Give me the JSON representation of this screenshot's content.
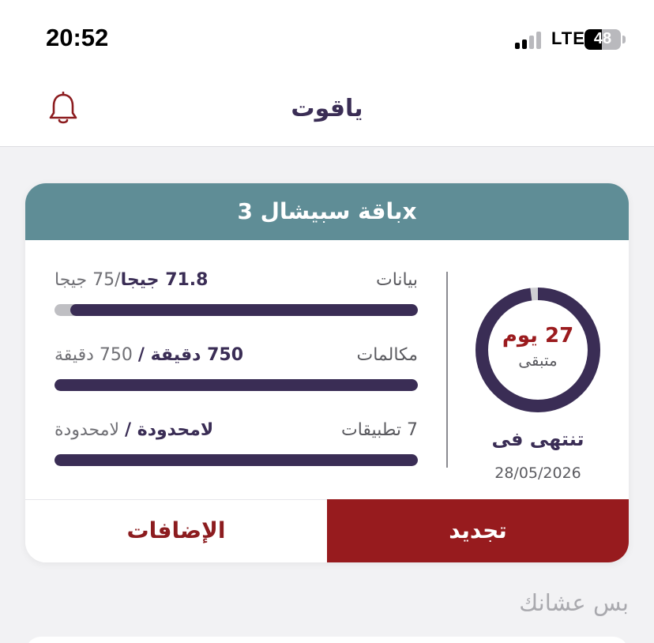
{
  "status_bar": {
    "time": "20:52",
    "network": "LTE",
    "battery": "48",
    "battery_level": 0.48
  },
  "nav": {
    "title": "ياقوت",
    "icon": "bell-icon"
  },
  "plan": {
    "name": "باقة سبيشال 3x",
    "usage": [
      {
        "label": "بيانات",
        "used": "71.8 جيجا",
        "total": "/75 جيجا",
        "remaining_fraction": 0.957
      },
      {
        "label": "مكالمات",
        "used": "750 دقيقة /",
        "total": "750 دقيقة",
        "remaining_fraction": 1.0
      },
      {
        "label": "7 تطبيقات",
        "used": "لامحدودة /",
        "total": "لامحدودة",
        "remaining_fraction": 1.0
      }
    ],
    "days_value": "27 يوم",
    "remaining_label": "متبقى",
    "days_fraction": 0.98,
    "expires_label": "تنتهى فى",
    "expiry_date": "28/05/2026",
    "addons_button": "الإضافات",
    "renew_button": "تجديد"
  },
  "section": {
    "title": "بس عشانك"
  },
  "colors": {
    "primary": "#3a2d55",
    "accent": "#971b1e",
    "header": "#5f8d96"
  }
}
